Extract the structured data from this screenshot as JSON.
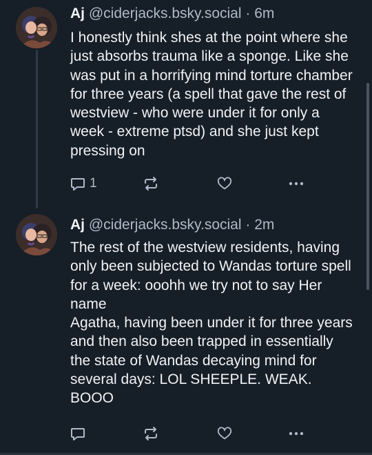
{
  "posts": [
    {
      "author": "Aj",
      "handle": "@ciderjacks.bsky.social",
      "separator": "·",
      "time": "6m",
      "text": "I honestly think shes at the point where she just absorbs trauma like a sponge. Like she was put in a horrifying mind torture chamber for three years (a spell that gave the rest of westview - who were under it for only a week - extreme ptsd) and she just kept pressing on",
      "reply_count": "1",
      "icons": [
        "reply-icon",
        "repost-icon",
        "like-icon",
        "more-icon"
      ]
    },
    {
      "author": "Aj",
      "handle": "@ciderjacks.bsky.social",
      "separator": "·",
      "time": "2m",
      "text": "The rest of the westview residents, having only been subjected to Wandas torture spell for a week: ooohh we try not to say Her name\nAgatha, having been under it for three years and then also been trapped in essentially the state of Wandas decaying mind for several days: LOL SHEEPLE. WEAK. BOOO",
      "reply_count": "",
      "icons": [
        "reply-icon",
        "repost-icon",
        "like-icon",
        "more-icon"
      ]
    }
  ],
  "colors": {
    "background": "#161e27",
    "text": "#f1f3f5",
    "muted": "#aebbc9",
    "thread_line": "#2e3a48"
  }
}
